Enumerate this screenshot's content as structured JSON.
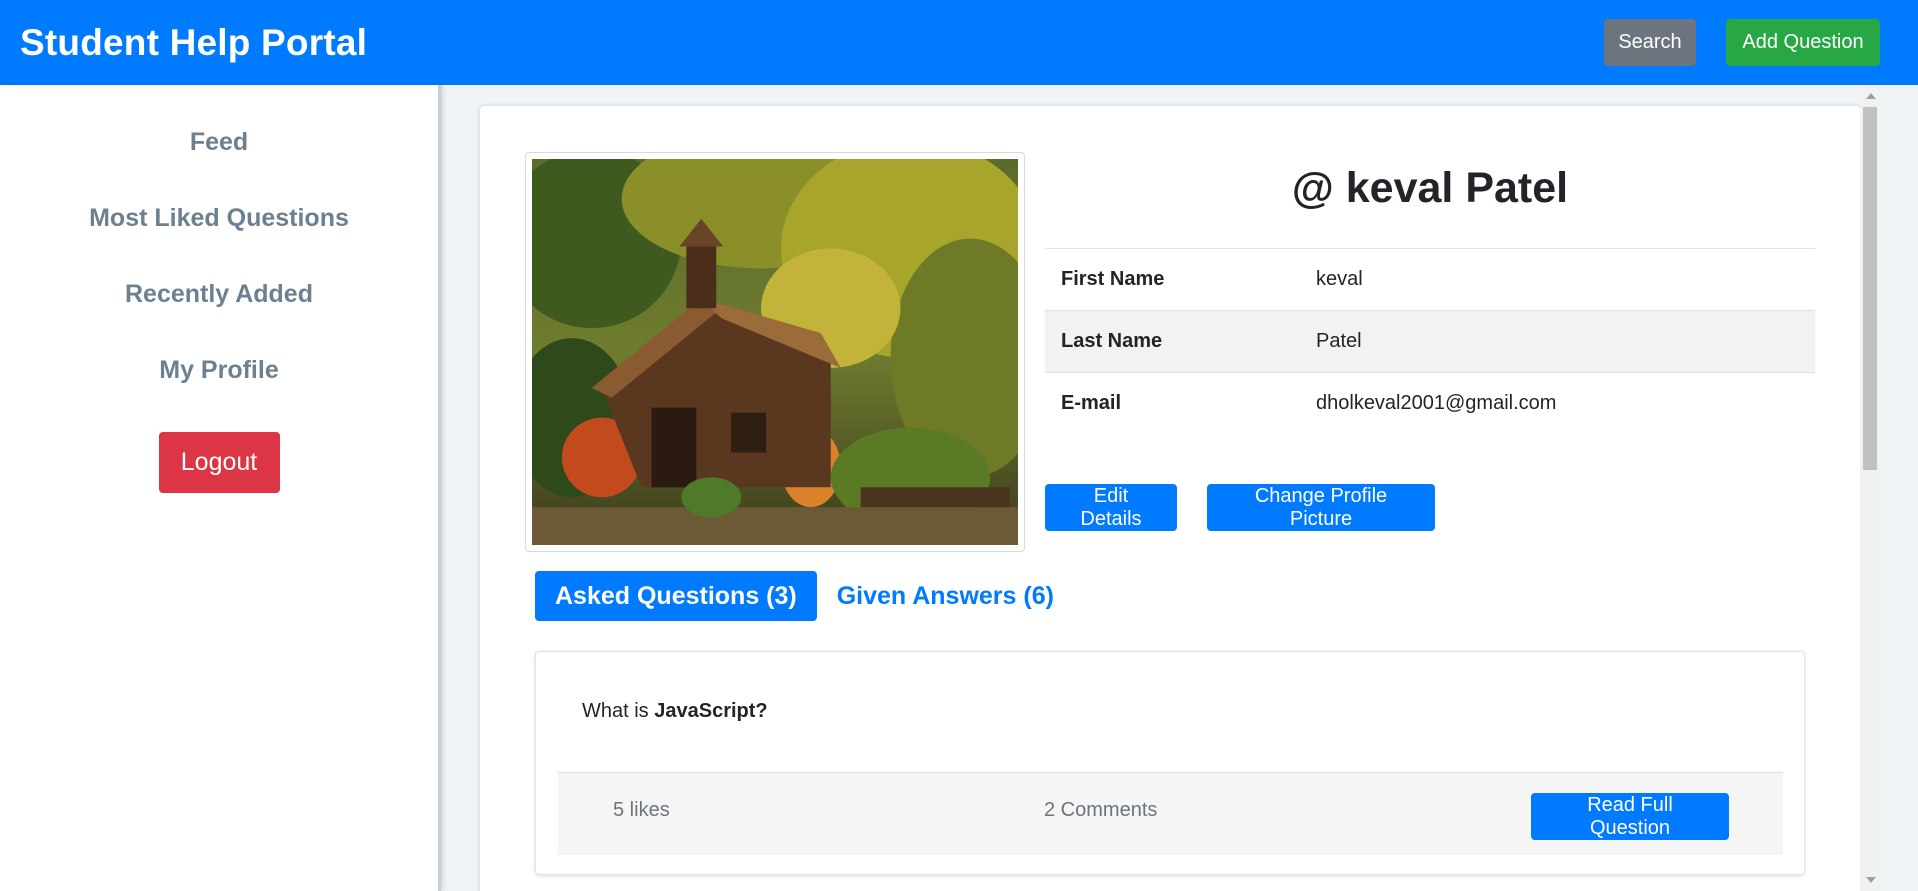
{
  "app": {
    "title": "Student Help Portal"
  },
  "header": {
    "search_label": "Search",
    "add_question_label": "Add Question"
  },
  "sidebar": {
    "items": [
      {
        "label": "Feed"
      },
      {
        "label": "Most Liked Questions"
      },
      {
        "label": "Recently Added"
      },
      {
        "label": "My Profile"
      }
    ],
    "logout_label": "Logout"
  },
  "profile": {
    "username": "@ keval Patel",
    "fields": [
      {
        "label": "First Name",
        "value": "keval"
      },
      {
        "label": "Last Name",
        "value": "Patel"
      },
      {
        "label": "E-mail",
        "value": "dholkeval2001@gmail.com"
      }
    ],
    "edit_label": "Edit Details",
    "change_picture_label": "Change Profile Picture",
    "photo_icon": "profile-photo-cabin-in-forest"
  },
  "tabs": [
    {
      "label": "Asked Questions (3)",
      "active": true
    },
    {
      "label": "Given Answers (6)",
      "active": false
    }
  ],
  "question": {
    "prefix": "What is",
    "topic": "JavaScript?",
    "likes": "5 likes",
    "comments": "2 Comments",
    "read_label": "Read Full Question"
  },
  "colors": {
    "primary": "#007bff",
    "success": "#28a745",
    "secondary": "#6c757d",
    "danger": "#dc3545"
  }
}
